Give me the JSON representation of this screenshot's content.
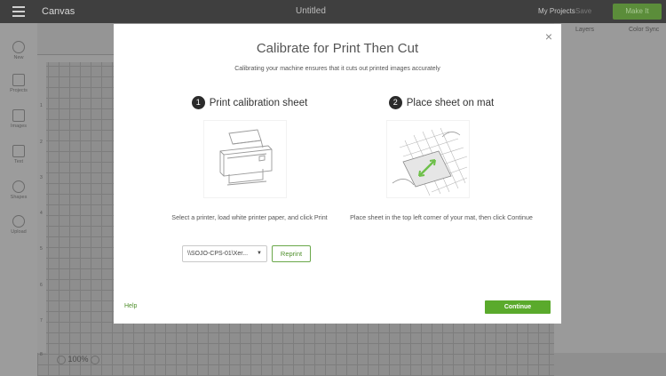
{
  "app": {
    "title": "Canvas",
    "document_title": "Untitled",
    "my_projects": "My Projects",
    "save": "Save",
    "make_it": "Make It"
  },
  "sidebar": {
    "items": [
      {
        "label": "New",
        "icon": "plus-icon"
      },
      {
        "label": "Projects",
        "icon": "projects-icon"
      },
      {
        "label": "Images",
        "icon": "images-icon"
      },
      {
        "label": "Text",
        "icon": "text-icon"
      },
      {
        "label": "Shapes",
        "icon": "shapes-icon"
      },
      {
        "label": "Upload",
        "icon": "upload-icon"
      }
    ]
  },
  "right_panel": {
    "tabs": [
      "Layers",
      "Color Sync"
    ]
  },
  "canvas": {
    "zoom": "100%",
    "ruler_numbers": [
      "1",
      "2",
      "3",
      "4",
      "5",
      "6",
      "7",
      "8"
    ]
  },
  "dialog": {
    "title": "Calibrate for Print Then Cut",
    "subtitle": "Calibrating your machine ensures that it cuts out printed images accurately",
    "step1": {
      "number": "1",
      "title": "Print calibration sheet",
      "caption": "Select a printer, load white printer paper, and click Print"
    },
    "step2": {
      "number": "2",
      "title": "Place sheet on mat",
      "caption": "Place sheet in the top left corner of your mat, then click Continue"
    },
    "printer_select": {
      "value": "\\\\SOJO-CPS-01\\Xer..."
    },
    "reprint_label": "Reprint",
    "help_label": "Help",
    "continue_label": "Continue",
    "close_glyph": "×"
  },
  "colors": {
    "accent_green": "#5aaa2c",
    "text_green": "#4e8f2b"
  }
}
